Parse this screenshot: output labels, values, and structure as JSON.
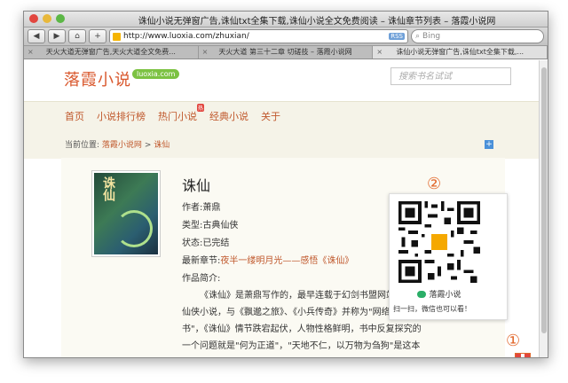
{
  "window": {
    "title": "诛仙小说无弹窗广告,诛仙txt全集下载,诛仙小说全文免费阅读 – 诛仙章节列表 – 落霞小说网",
    "url": "http://www.luoxia.com/zhuxian/",
    "search_placeholder": "Bing",
    "rss_label": "RSS"
  },
  "tabs": [
    {
      "label": "天火大道无弹窗广告,天火大道全文免费...",
      "active": false
    },
    {
      "label": "天火大道 第三十二章 切磋技 – 落霞小说网",
      "active": false
    },
    {
      "label": "诛仙小说无弹窗广告,诛仙txt全集下载,...",
      "active": true
    }
  ],
  "site": {
    "logo": "落霞小说",
    "logo_badge": "luoxia.com",
    "search_placeholder": "搜索书名试试"
  },
  "nav": {
    "items": [
      "首页",
      "小说排行榜",
      "热门小说",
      "经典小说",
      "关于"
    ],
    "hot_badge": "热"
  },
  "breadcrumb": {
    "prefix": "当前位置:",
    "home": "落霞小说网",
    "sep": ">",
    "current": "诛仙"
  },
  "book": {
    "cover_text": "诛仙",
    "title": "诛仙",
    "author_label": "作者:",
    "author": "萧鼎",
    "type_label": "类型:",
    "type": "古典仙侠",
    "status_label": "状态:",
    "status": "已完结",
    "latest_label": "最新章节:",
    "latest": "夜半一缕明月光——感悟《诛仙》",
    "intro_label": "作品简介:",
    "description": "《诛仙》是萧鼎写作的，最早连载于幻剑书盟网站的一部仙侠小说，与《飘邈之旅》、《小兵传奇》并称为\"网络三大奇书\"，《诛仙》情节跌宕起伏，人物性格鲜明，书中反复探究的一个问题就是\"何为正道\"，\"天地不仁，以万物为刍狗\"是这本小说的主题思想。"
  },
  "qr": {
    "name": "落霞小说",
    "caption": "扫一扫，微信也可以看！",
    "marker1": "①",
    "marker2": "②"
  }
}
